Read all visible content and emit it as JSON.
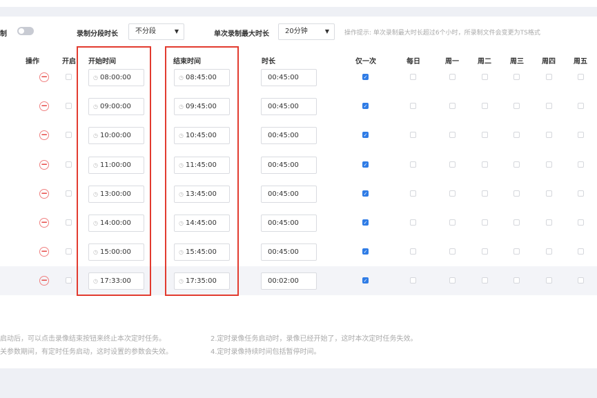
{
  "toolbar": {
    "record_label": "制",
    "segment_label": "录制分段时长",
    "segment_value": "不分段",
    "max_label": "单次录制最大时长",
    "max_value": "20分钟",
    "hint": "操作提示: 单次录制最大时长超过6个小时，所录制文件会变更为TS格式"
  },
  "table": {
    "headers": {
      "op": "操作",
      "enable": "开启",
      "start": "开始时间",
      "end": "结束时间",
      "duration": "时长",
      "once": "仅一次",
      "daily": "每日",
      "mon": "周一",
      "tue": "周二",
      "wed": "周三",
      "thu": "周四",
      "fri": "周五"
    },
    "rows": [
      {
        "start": "08:00:00",
        "end": "08:45:00",
        "duration": "00:45:00",
        "once": true
      },
      {
        "start": "09:00:00",
        "end": "09:45:00",
        "duration": "00:45:00",
        "once": true
      },
      {
        "start": "10:00:00",
        "end": "10:45:00",
        "duration": "00:45:00",
        "once": true
      },
      {
        "start": "11:00:00",
        "end": "11:45:00",
        "duration": "00:45:00",
        "once": true
      },
      {
        "start": "13:00:00",
        "end": "13:45:00",
        "duration": "00:45:00",
        "once": true
      },
      {
        "start": "14:00:00",
        "end": "14:45:00",
        "duration": "00:45:00",
        "once": true
      },
      {
        "start": "15:00:00",
        "end": "15:45:00",
        "duration": "00:45:00",
        "once": true
      },
      {
        "start": "17:33:00",
        "end": "17:35:00",
        "duration": "00:02:00",
        "once": true
      }
    ]
  },
  "notes": {
    "n1": "启动后，可以点击录像结束按钮来终止本次定时任务。",
    "n2": "2.定时录像任务启动时，录像已经开始了，这时本次定时任务失效。",
    "n3": "关参数期间，有定时任务启动，这时设置的参数会失效。",
    "n4": "4.定时录像持续时间包括暂停时间。"
  },
  "icons": {
    "minus": "minus-circle-icon",
    "clock": "clock-icon",
    "caret": "caret-down-icon",
    "check": "checkmark-icon"
  },
  "colors": {
    "accent": "#2f7ce6",
    "delete": "#e53935",
    "highlight_frame": "#e23a2e"
  }
}
